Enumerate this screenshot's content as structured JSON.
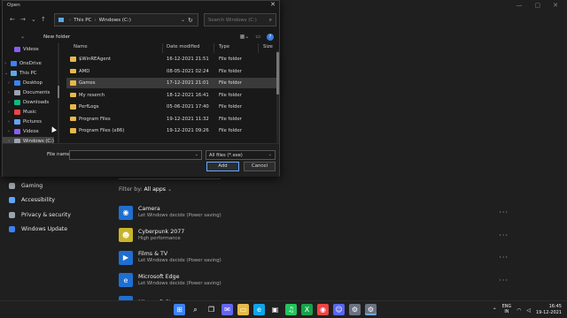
{
  "dialog": {
    "title": "Open",
    "close_glyph": "✕",
    "breadcrumb": [
      "This PC",
      "Windows (C:)"
    ],
    "search_placeholder": "Search Windows (C:)",
    "new_folder": "New folder",
    "columns": {
      "name": "Name",
      "date": "Date modified",
      "type": "Type",
      "size": "Size"
    },
    "nav": [
      {
        "label": "Videos",
        "icon": "videos-icon",
        "color": "#8b5cf6",
        "chev": "",
        "indent": 1
      },
      {
        "label": "OneDrive",
        "icon": "cloud-icon",
        "color": "#3b82f6",
        "chev": "›",
        "indent": 0
      },
      {
        "label": "This PC",
        "icon": "pc-icon",
        "color": "#5aa9e6",
        "chev": "⌄",
        "indent": 0
      },
      {
        "label": "Desktop",
        "icon": "desktop-icon",
        "color": "#3b82f6",
        "chev": "›",
        "indent": 1
      },
      {
        "label": "Documents",
        "icon": "documents-icon",
        "color": "#9ca3af",
        "chev": "›",
        "indent": 1
      },
      {
        "label": "Downloads",
        "icon": "downloads-icon",
        "color": "#10b981",
        "chev": "›",
        "indent": 1
      },
      {
        "label": "Music",
        "icon": "music-icon",
        "color": "#ef4444",
        "chev": "›",
        "indent": 1
      },
      {
        "label": "Pictures",
        "icon": "pictures-icon",
        "color": "#60a5fa",
        "chev": "›",
        "indent": 1
      },
      {
        "label": "Videos",
        "icon": "videos-icon",
        "color": "#8b5cf6",
        "chev": "›",
        "indent": 1
      },
      {
        "label": "Windows (C:)",
        "icon": "drive-icon",
        "color": "#9ca3af",
        "chev": "›",
        "indent": 1
      }
    ],
    "files": [
      {
        "name": "$WinREAgent",
        "date": "16-12-2021 21:51",
        "type": "File folder"
      },
      {
        "name": "AMD",
        "date": "08-05-2021 02:24",
        "type": "File folder"
      },
      {
        "name": "Games",
        "date": "17-12-2021 21:01",
        "type": "File folder"
      },
      {
        "name": "My reserch",
        "date": "18-12-2021 16:41",
        "type": "File folder"
      },
      {
        "name": "PerfLogs",
        "date": "05-06-2021 17:40",
        "type": "File folder"
      },
      {
        "name": "Program Files",
        "date": "19-12-2021 11:32",
        "type": "File folder"
      },
      {
        "name": "Program Files (x86)",
        "date": "19-12-2021 09:26",
        "type": "File folder"
      }
    ],
    "file_name_label": "File name:",
    "file_name_value": "",
    "file_type": "All files (*.exe)",
    "add_label": "Add",
    "cancel_label": "Cancel"
  },
  "settings": {
    "nav": [
      {
        "label": "Gaming",
        "icon": "gaming-icon",
        "color": "#9ca3af"
      },
      {
        "label": "Accessibility",
        "icon": "accessibility-icon",
        "color": "#60a5fa"
      },
      {
        "label": "Privacy & security",
        "icon": "shield-icon",
        "color": "#9ca3af"
      },
      {
        "label": "Windows Update",
        "icon": "update-icon",
        "color": "#3b82f6"
      }
    ],
    "filter_label": "Filter by:",
    "filter_value": "All apps",
    "apps": [
      {
        "name": "Camera",
        "sub": "Let Windows decide (Power saving)",
        "icon": "camera-icon",
        "color": "#1f6fd1",
        "glyph": "◉"
      },
      {
        "name": "Cyberpunk 2077",
        "sub": "High performance",
        "icon": "cyberpunk-icon",
        "color": "#c9b52a",
        "glyph": "☻"
      },
      {
        "name": "Films & TV",
        "sub": "Let Windows decide (Power saving)",
        "icon": "films-icon",
        "color": "#1f6fd1",
        "glyph": "▶"
      },
      {
        "name": "Microsoft Edge",
        "sub": "Let Windows decide (Power saving)",
        "icon": "edge-icon",
        "color": "#1f6fd1",
        "glyph": "e"
      },
      {
        "name": "Microsoft Store",
        "sub": "",
        "icon": "store-icon",
        "color": "#1f6fd1",
        "glyph": "▣"
      }
    ],
    "window_controls": [
      "—",
      "▢",
      "✕"
    ]
  },
  "taskbar": {
    "icons": [
      {
        "name": "start-icon",
        "color": "#3b82f6",
        "glyph": "⊞"
      },
      {
        "name": "search-icon",
        "color": "#202020",
        "glyph": "⌕"
      },
      {
        "name": "task-view-icon",
        "color": "#202020",
        "glyph": "❐"
      },
      {
        "name": "chat-icon",
        "color": "#6366f1",
        "glyph": "✉"
      },
      {
        "name": "explorer-icon",
        "color": "#e8b948",
        "glyph": "▭"
      },
      {
        "name": "edge-icon",
        "color": "#0ea5e9",
        "glyph": "e"
      },
      {
        "name": "store-icon",
        "color": "#202020",
        "glyph": "▣"
      },
      {
        "name": "spotify-icon",
        "color": "#22c55e",
        "glyph": "♫"
      },
      {
        "name": "xbox-icon",
        "color": "#16a34a",
        "glyph": "X"
      },
      {
        "name": "camera-icon",
        "color": "#ef4444",
        "glyph": "◉"
      },
      {
        "name": "discord-icon",
        "color": "#5865f2",
        "glyph": "☺"
      },
      {
        "name": "settings-icon",
        "color": "#6b7280",
        "glyph": "⚙"
      },
      {
        "name": "settings-icon-2",
        "color": "#6b7280",
        "glyph": "⚙"
      }
    ],
    "lang_1": "ENG",
    "lang_2": "IN",
    "time": "16:45",
    "date": "19-12-2021"
  }
}
